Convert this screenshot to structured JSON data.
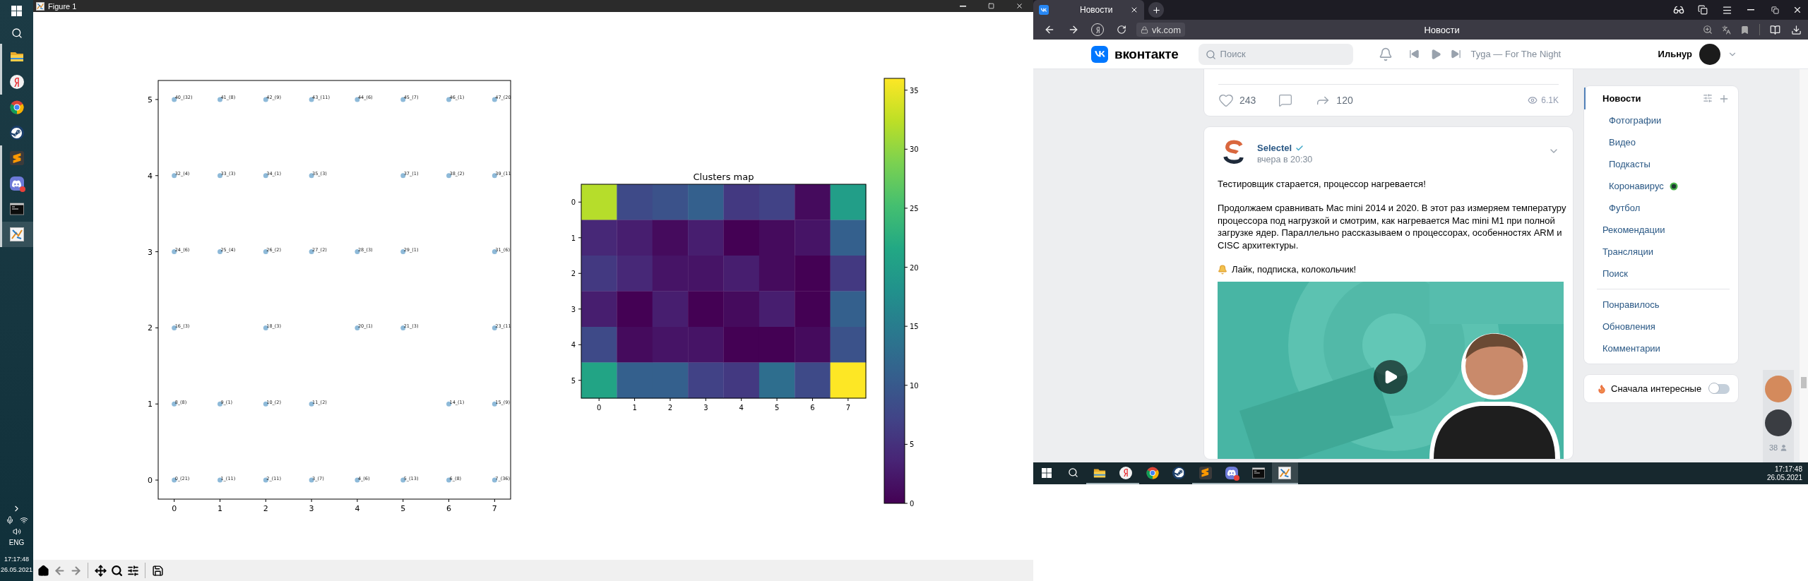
{
  "left_taskbar": {
    "apps": [
      {
        "running": true,
        "selected": false
      },
      {
        "running": true,
        "selected": false
      },
      {
        "running": false,
        "selected": false
      },
      {
        "running": false,
        "selected": false
      },
      {
        "running": true,
        "selected": false
      },
      {
        "running": true,
        "selected": false
      },
      {
        "running": true,
        "selected": false
      },
      {
        "running": true,
        "selected": true
      }
    ],
    "tray": {
      "language": "ENG",
      "time": "17:17:48",
      "date": "26.05.2021"
    }
  },
  "figure_window": {
    "title": "Figure 1",
    "scatter": {
      "chart_data": {
        "type": "scatter",
        "xlim": [
          -0.35,
          7.35
        ],
        "ylim": [
          -0.25,
          5.25
        ],
        "xticks": [
          {
            "value": 0,
            "label": "0"
          },
          {
            "value": 1,
            "label": "1"
          },
          {
            "value": 2,
            "label": "2"
          },
          {
            "value": 3,
            "label": "3"
          },
          {
            "value": 4,
            "label": "4"
          },
          {
            "value": 5,
            "label": "5"
          },
          {
            "value": 6,
            "label": "6"
          },
          {
            "value": 7,
            "label": "7"
          }
        ],
        "yticks": [
          {
            "value": 0,
            "label": "0"
          },
          {
            "value": 1,
            "label": "1"
          },
          {
            "value": 2,
            "label": "2"
          },
          {
            "value": 3,
            "label": "3"
          },
          {
            "value": 4,
            "label": "4"
          },
          {
            "value": 5,
            "label": "5"
          }
        ],
        "x": [
          0,
          1,
          2,
          3,
          4,
          5,
          6,
          7,
          0,
          1,
          2,
          3,
          5,
          6,
          7,
          0,
          1,
          2,
          3,
          4,
          5,
          7,
          0,
          2,
          4,
          5,
          7,
          0,
          1,
          2,
          3,
          6,
          7,
          0,
          1,
          2,
          3,
          4,
          5,
          6,
          7
        ],
        "series": [
          {
            "color": "#8ebad9",
            "values": [
              5,
              5,
              5,
              5,
              5,
              5,
              5,
              5,
              4,
              4,
              4,
              4,
              4,
              4,
              4,
              3,
              3,
              3,
              3,
              3,
              3,
              3,
              2,
              2,
              2,
              2,
              2,
              1,
              1,
              1,
              1,
              1,
              1,
              0,
              0,
              0,
              0,
              0,
              0,
              0,
              0
            ]
          }
        ],
        "annotations": [
          {
            "x": 0,
            "y": 5,
            "text": "40_(32)"
          },
          {
            "x": 1,
            "y": 5,
            "text": "41_(8)"
          },
          {
            "x": 2,
            "y": 5,
            "text": "42_(9)"
          },
          {
            "x": 3,
            "y": 5,
            "text": "43_(11)"
          },
          {
            "x": 4,
            "y": 5,
            "text": "44_(6)"
          },
          {
            "x": 5,
            "y": 5,
            "text": "45_(7)"
          },
          {
            "x": 6,
            "y": 5,
            "text": "46_(1)"
          },
          {
            "x": 7,
            "y": 5,
            "text": "47_(20"
          },
          {
            "x": 0,
            "y": 4,
            "text": "32_(4)"
          },
          {
            "x": 1,
            "y": 4,
            "text": "33_(3)"
          },
          {
            "x": 2,
            "y": 4,
            "text": "34_(1)"
          },
          {
            "x": 3,
            "y": 4,
            "text": "35_(3)"
          },
          {
            "x": 5,
            "y": 4,
            "text": "37_(1)"
          },
          {
            "x": 6,
            "y": 4,
            "text": "38_(2)"
          },
          {
            "x": 7,
            "y": 4,
            "text": "39_(11"
          },
          {
            "x": 0,
            "y": 3,
            "text": "24_(6)"
          },
          {
            "x": 1,
            "y": 3,
            "text": "25_(4)"
          },
          {
            "x": 2,
            "y": 3,
            "text": "26_(2)"
          },
          {
            "x": 3,
            "y": 3,
            "text": "27_(2)"
          },
          {
            "x": 4,
            "y": 3,
            "text": "28_(3)"
          },
          {
            "x": 5,
            "y": 3,
            "text": "29_(1)"
          },
          {
            "x": 7,
            "y": 3,
            "text": "31_(6)"
          },
          {
            "x": 0,
            "y": 2,
            "text": "16_(3)"
          },
          {
            "x": 2,
            "y": 2,
            "text": "18_(3)"
          },
          {
            "x": 4,
            "y": 2,
            "text": "20_(1)"
          },
          {
            "x": 5,
            "y": 2,
            "text": "21_(3)"
          },
          {
            "x": 7,
            "y": 2,
            "text": "23_(11"
          },
          {
            "x": 0,
            "y": 1,
            "text": "8_(8)"
          },
          {
            "x": 1,
            "y": 1,
            "text": "9_(1)"
          },
          {
            "x": 2,
            "y": 1,
            "text": "10_(2)"
          },
          {
            "x": 3,
            "y": 1,
            "text": "11_(2)"
          },
          {
            "x": 6,
            "y": 1,
            "text": "14_(1)"
          },
          {
            "x": 7,
            "y": 1,
            "text": "15_(9)"
          },
          {
            "x": 0,
            "y": 0,
            "text": "0_(21)"
          },
          {
            "x": 1,
            "y": 0,
            "text": "1_(11)"
          },
          {
            "x": 2,
            "y": 0,
            "text": "2_(11)"
          },
          {
            "x": 3,
            "y": 0,
            "text": "3_(7)"
          },
          {
            "x": 4,
            "y": 0,
            "text": "4_(6)"
          },
          {
            "x": 5,
            "y": 0,
            "text": "5_(13)"
          },
          {
            "x": 6,
            "y": 0,
            "text": "6_(8)"
          },
          {
            "x": 7,
            "y": 0,
            "text": "7_(36)"
          }
        ]
      }
    },
    "heatmap": {
      "title": "Clusters map",
      "x_tick_labels": [
        "0",
        "1",
        "2",
        "3",
        "4",
        "5",
        "6",
        "7"
      ],
      "y_tick_labels": [
        "0",
        "1",
        "2",
        "3",
        "4",
        "5"
      ],
      "colorbar_labels": [
        "35",
        "30",
        "25",
        "20",
        "15",
        "10",
        "5",
        "0"
      ],
      "rows": [
        [
          {
            "color": "#b6dd2b"
          },
          {
            "color": "#3e4a88"
          },
          {
            "color": "#3b528a"
          },
          {
            "color": "#34608d"
          },
          {
            "color": "#433981"
          },
          {
            "color": "#414286"
          },
          {
            "color": "#450b5d"
          },
          {
            "color": "#229e88"
          }
        ],
        [
          {
            "color": "#472877"
          },
          {
            "color": "#471e6f"
          },
          {
            "color": "#450b5d"
          },
          {
            "color": "#471e6f"
          },
          {
            "color": "#440154"
          },
          {
            "color": "#450b5d"
          },
          {
            "color": "#461466"
          },
          {
            "color": "#34608d"
          }
        ],
        [
          {
            "color": "#433981"
          },
          {
            "color": "#472877"
          },
          {
            "color": "#461466"
          },
          {
            "color": "#461466"
          },
          {
            "color": "#471e6f"
          },
          {
            "color": "#450b5d"
          },
          {
            "color": "#440154"
          },
          {
            "color": "#433981"
          }
        ],
        [
          {
            "color": "#471e6f"
          },
          {
            "color": "#440154"
          },
          {
            "color": "#471e6f"
          },
          {
            "color": "#440154"
          },
          {
            "color": "#450b5d"
          },
          {
            "color": "#471e6f"
          },
          {
            "color": "#440154"
          },
          {
            "color": "#34608d"
          }
        ],
        [
          {
            "color": "#3e4a88"
          },
          {
            "color": "#450b5d"
          },
          {
            "color": "#461466"
          },
          {
            "color": "#461466"
          },
          {
            "color": "#440154"
          },
          {
            "color": "#440154"
          },
          {
            "color": "#450b5d"
          },
          {
            "color": "#3b528a"
          }
        ],
        [
          {
            "color": "#22a485"
          },
          {
            "color": "#34608d"
          },
          {
            "color": "#34608d"
          },
          {
            "color": "#414286"
          },
          {
            "color": "#433981"
          },
          {
            "color": "#2e6e8e"
          },
          {
            "color": "#3e4a88"
          },
          {
            "color": "#fde725"
          }
        ]
      ]
    }
  },
  "browser": {
    "tabs": [
      {
        "title": "Новости",
        "selected": true
      }
    ],
    "address": "vk.com",
    "page_title": "Новости"
  },
  "vk": {
    "logo_text": "вконтакте",
    "search": {
      "placeholder": "Поиск"
    },
    "now_playing": "Tyga — For The Night",
    "user_name": "Ильнур",
    "previous_post": {
      "likes": "243",
      "shares": "120",
      "views": "6.1K"
    },
    "post": {
      "author": "Selectel",
      "verified": true,
      "time": "вчера в 20:30",
      "paragraphs": [
        {
          "kind": "plain",
          "text": "Тестировщик старается, процессор нагревается!"
        },
        {
          "kind": "plain",
          "text": "Продолжаем сравнивать Mac mini 2014 и 2020. В этот раз измеряем температуру процессора под нагрузкой и смотрим, как нагревается Mac mini M1 при полной загрузке ядер. Параллельно рассказываем о процессорах, особенностях ARM и CISC архитектуры."
        },
        {
          "kind": "bell",
          "text": "Лайк, подписка, колокольчик!"
        }
      ]
    },
    "menu": {
      "groups": [
        [
          {
            "label": "Новости",
            "selected": true,
            "children": [
              {
                "label": "Фотографии",
                "selected": false,
                "icon": false
              },
              {
                "label": "Видео",
                "selected": false,
                "icon": false
              },
              {
                "label": "Подкасты",
                "selected": false,
                "icon": false
              },
              {
                "label": "Коронавирус",
                "selected": false,
                "icon": true
              },
              {
                "label": "Футбол",
                "selected": false,
                "icon": false
              }
            ]
          },
          {
            "label": "Рекомендации",
            "selected": false
          },
          {
            "label": "Трансляции",
            "selected": false
          },
          {
            "label": "Поиск",
            "selected": false
          }
        ],
        [
          {
            "label": "Понравилось",
            "selected": false
          },
          {
            "label": "Обновления",
            "selected": false
          },
          {
            "label": "Комментарии",
            "selected": false
          }
        ]
      ]
    },
    "sort_toggle": {
      "label": "Сначала интересные",
      "on": false
    },
    "chat": {
      "online_count": "38"
    }
  },
  "windows_taskbar": {
    "apps": [
      {
        "running": true,
        "selected": false
      },
      {
        "running": true,
        "selected": false
      },
      {
        "running": false,
        "selected": false
      },
      {
        "running": false,
        "selected": false
      },
      {
        "running": true,
        "selected": false
      },
      {
        "running": true,
        "selected": false
      },
      {
        "running": true,
        "selected": false
      },
      {
        "running": true,
        "selected": true
      }
    ],
    "time": "17:17:48",
    "date": "26.05.2021"
  }
}
